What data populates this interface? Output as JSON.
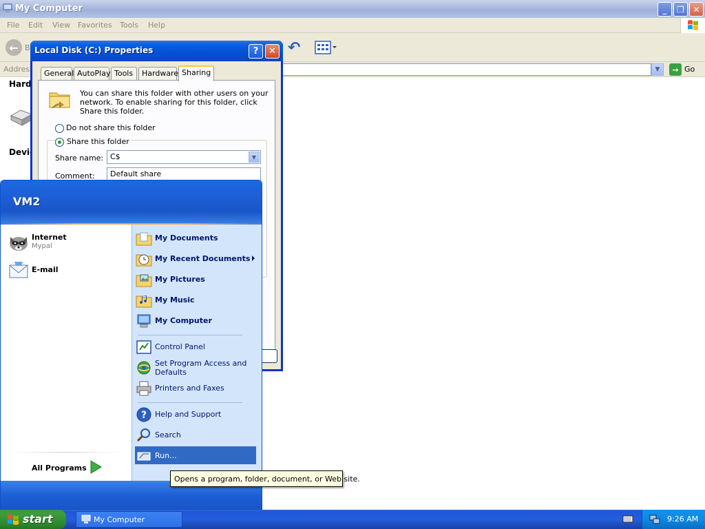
{
  "explorer": {
    "title": "My Computer",
    "menu": [
      "File",
      "Edit",
      "View",
      "Favorites",
      "Tools",
      "Help"
    ],
    "back_label": "B",
    "address_label": "Address",
    "go_label": "Go",
    "group_hard": "Hard",
    "group_devices": "Devic"
  },
  "dialog": {
    "title": "Local Disk (C:) Properties",
    "help_label": "?",
    "close_label": "✕",
    "tabs": [
      "General",
      "AutoPlay",
      "Tools",
      "Hardware",
      "Sharing"
    ],
    "active_tab": "Sharing",
    "description": "You can share this folder with other users on your network.  To enable sharing for this folder, click Share this folder.",
    "option_no_share": "Do not share this folder",
    "option_share": "Share this folder",
    "share_name_label": "Share name:",
    "share_name_value": "C$",
    "comment_label": "Comment:",
    "comment_value": "Default share"
  },
  "start_menu": {
    "user": "VM2",
    "pinned": [
      {
        "main": "Internet",
        "sub": "Mypal"
      },
      {
        "main": "E-mail",
        "sub": ""
      }
    ],
    "all_programs": "All Programs",
    "right_items": [
      "My Documents",
      "My Recent Documents",
      "My Pictures",
      "My Music",
      "My Computer",
      "Control Panel",
      "Set Program Access and Defaults",
      "Printers and Faxes",
      "Help and Support",
      "Search",
      "Run..."
    ],
    "tooltip": "Opens a program, folder, document, or Web site."
  },
  "taskbar": {
    "start_label": "start",
    "task_button": "My Computer",
    "clock": "9:26 AM"
  },
  "colors": {
    "xp_blue": "#245edb",
    "start_green": "#3c9a3c",
    "highlight": "#316ac5"
  }
}
